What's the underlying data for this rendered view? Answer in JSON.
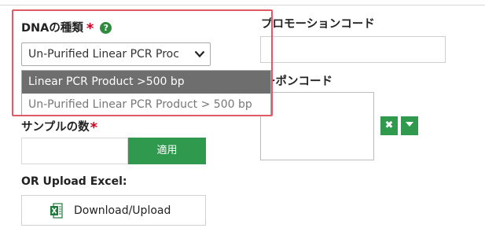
{
  "dna_type": {
    "label": "DNAの種類",
    "required_mark": "*",
    "help_icon": "question-circle-icon",
    "selected_value": "Un-Purified Linear PCR Proc",
    "options": [
      "Linear PCR Product >500 bp",
      "Un-Purified Linear PCR Product > 500 bp"
    ],
    "highlighted_option_index": 0
  },
  "sample_count": {
    "label": "サンプルの数",
    "required_mark": "*",
    "value": "",
    "apply_label": "適用"
  },
  "upload": {
    "label": "OR Upload Excel:",
    "button_label": "Download/Upload",
    "icon": "excel-icon"
  },
  "promo_code": {
    "label": "プロモーションコード",
    "value": ""
  },
  "coupon_code": {
    "label_visible": "ーポンコード",
    "remove_icon": "close-icon",
    "menu_icon": "caret-down-icon"
  },
  "colors": {
    "accent_green": "#2f9a4e",
    "highlight_border": "#e05a66",
    "required_red": "#d0021b",
    "selected_option_bg": "#6e6e6e"
  }
}
